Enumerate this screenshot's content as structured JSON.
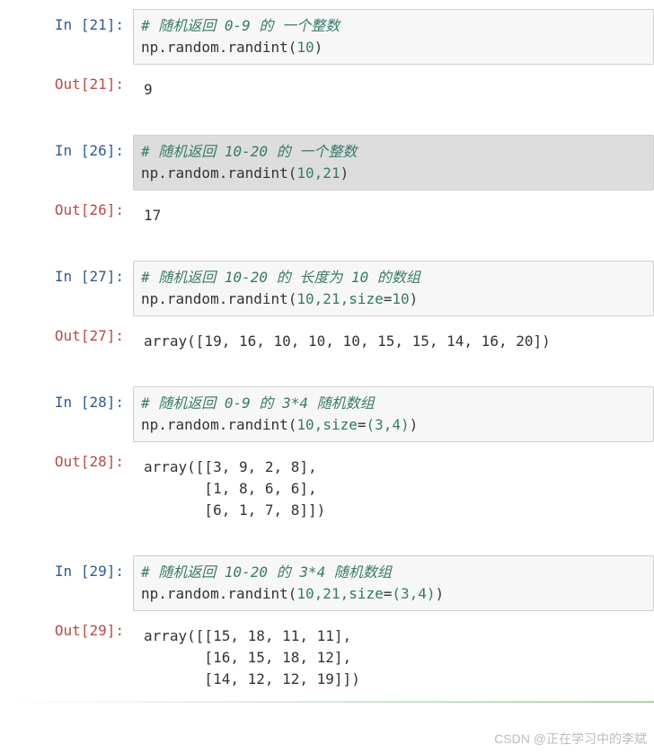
{
  "watermark": "CSDN @正在学习中的李斌",
  "cells": [
    {
      "in_num": "21",
      "comment": "# 随机返回 0-9 的 一个整数",
      "code_prefix": "np.random.randint",
      "args_plain": "10",
      "out_num": "21",
      "output": "9",
      "highlighted": false
    },
    {
      "in_num": "26",
      "comment": "# 随机返回 10-20 的 一个整数",
      "code_prefix": "np.random.randint",
      "args_plain": "10,21",
      "out_num": "26",
      "output": "17",
      "highlighted": true
    },
    {
      "in_num": "27",
      "comment": "# 随机返回 10-20 的 长度为 10 的数组",
      "code_prefix": "np.random.randint",
      "args_prefix": "10,21,",
      "kw_name": "size",
      "kw_eq": "=",
      "kw_val": "10",
      "out_num": "27",
      "output": "array([19, 16, 10, 10, 10, 15, 15, 14, 16, 20])",
      "highlighted": false
    },
    {
      "in_num": "28",
      "comment": "# 随机返回 0-9 的 3*4 随机数组",
      "code_prefix": "np.random.randint",
      "args_prefix": "10,",
      "kw_name": "size",
      "kw_eq": "=",
      "kw_tuple": "(3,4)",
      "out_num": "28",
      "output": "array([[3, 9, 2, 8],\n       [1, 8, 6, 6],\n       [6, 1, 7, 8]])",
      "highlighted": false
    },
    {
      "in_num": "29",
      "comment": "# 随机返回 10-20 的 3*4 随机数组",
      "code_prefix": "np.random.randint",
      "args_prefix": "10,21,",
      "kw_name": "size",
      "kw_eq": "=",
      "kw_tuple": "(3,4)",
      "out_num": "29",
      "output": "array([[15, 18, 11, 11],\n       [16, 15, 18, 12],\n       [14, 12, 12, 19]])",
      "highlighted": false
    }
  ],
  "labels": {
    "in": "In ",
    "out": "Out",
    "colon": ":",
    "lb": "[",
    "rb": "]",
    "lp": "(",
    "rp": ")"
  }
}
